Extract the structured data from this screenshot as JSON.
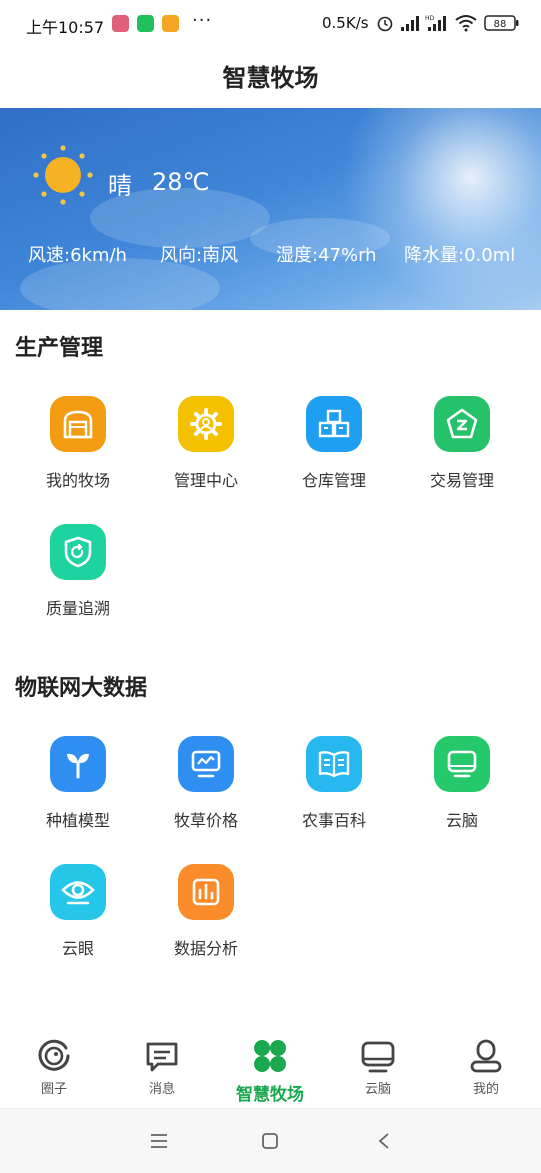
{
  "status_bar": {
    "time": "上午10:57",
    "more": "···",
    "net_speed": "0.5K/s",
    "battery": "88",
    "hd": "HD"
  },
  "header": {
    "title": "智慧牧场"
  },
  "weather": {
    "condition": "晴",
    "temperature": "28℃",
    "wind_speed": "风速:6km/h",
    "wind_direction": "风向:南风",
    "humidity": "湿度:47%rh",
    "precipitation": "降水量:0.0ml"
  },
  "production": {
    "title": "生产管理",
    "items": [
      {
        "label": "我的牧场",
        "icon": "barn-icon",
        "color": "#f39c12"
      },
      {
        "label": "管理中心",
        "icon": "gear-icon",
        "color": "#f5c000"
      },
      {
        "label": "仓库管理",
        "icon": "boxes-icon",
        "color": "#1e9ff2"
      },
      {
        "label": "交易管理",
        "icon": "trade-icon",
        "color": "#25c26b"
      },
      {
        "label": "质量追溯",
        "icon": "shield-icon",
        "color": "#1fd3a0"
      }
    ]
  },
  "iot": {
    "title": "物联网大数据",
    "items": [
      {
        "label": "种植模型",
        "icon": "sprout-icon",
        "color": "#2f8ff0"
      },
      {
        "label": "牧草价格",
        "icon": "chart-monitor-icon",
        "color": "#2f8ff0"
      },
      {
        "label": "农事百科",
        "icon": "book-icon",
        "color": "#28b8f0"
      },
      {
        "label": "云脑",
        "icon": "monitor-icon",
        "color": "#25c96c"
      },
      {
        "label": "云眼",
        "icon": "eye-icon",
        "color": "#26c6e8"
      },
      {
        "label": "数据分析",
        "icon": "bar-chart-icon",
        "color": "#fb8c2a"
      }
    ]
  },
  "bottom_nav": {
    "items": [
      {
        "label": "圈子",
        "icon": "circle-face-icon"
      },
      {
        "label": "消息",
        "icon": "message-icon"
      },
      {
        "label": "智慧牧场",
        "icon": "clover-icon",
        "active": true
      },
      {
        "label": "云脑",
        "icon": "monitor-icon"
      },
      {
        "label": "我的",
        "icon": "user-icon"
      }
    ],
    "active_color": "#1aa84f"
  }
}
